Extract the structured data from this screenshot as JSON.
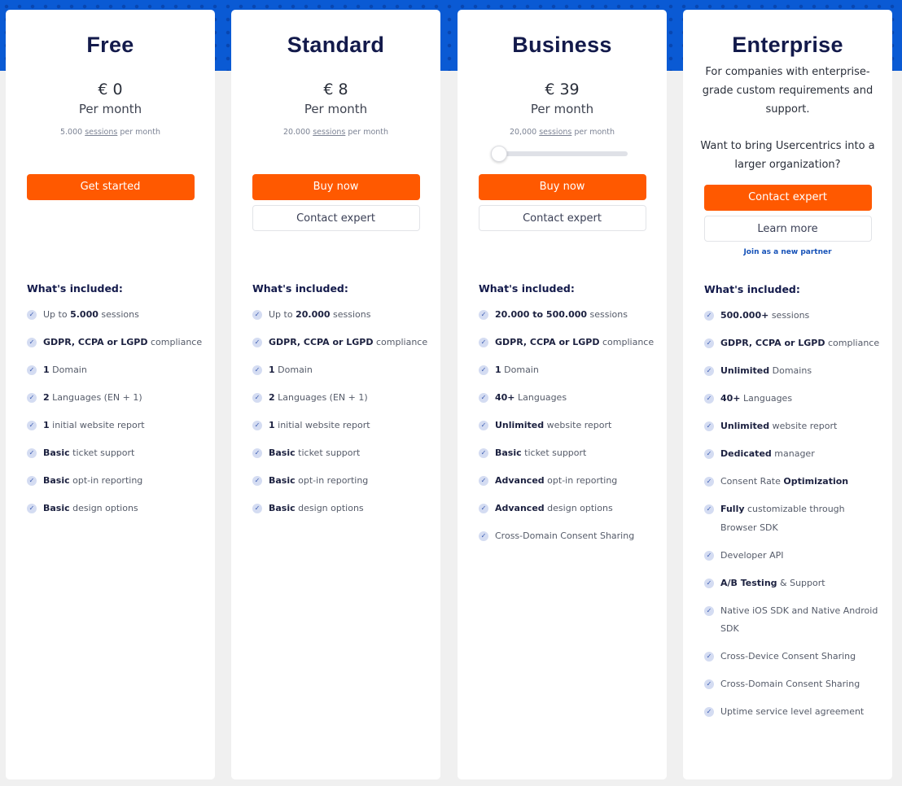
{
  "colors": {
    "accent": "#ff5900",
    "brand_blue": "#0a5ad4",
    "heading": "#131a4b"
  },
  "plans": [
    {
      "title": "Free",
      "price": "€ 0",
      "per": "Per month",
      "sessions_count": "5.000",
      "sessions_link": "sessions",
      "sessions_suffix": "per month",
      "primary": "Get started",
      "features_title": "What's included:",
      "features": [
        [
          {
            "t": "Up to "
          },
          {
            "t": "5.000",
            "b": 1
          },
          {
            "t": " sessions"
          }
        ],
        [
          {
            "t": "GDPR, CCPA or LGPD",
            "b": 1
          },
          {
            "t": " compliance"
          }
        ],
        [
          {
            "t": "1",
            "b": 1
          },
          {
            "t": " Domain"
          }
        ],
        [
          {
            "t": "2",
            "b": 1
          },
          {
            "t": " Languages (EN + 1)"
          }
        ],
        [
          {
            "t": "1",
            "b": 1
          },
          {
            "t": " initial website report"
          }
        ],
        [
          {
            "t": "Basic",
            "b": 1
          },
          {
            "t": " ticket support"
          }
        ],
        [
          {
            "t": "Basic",
            "b": 1
          },
          {
            "t": " opt-in reporting"
          }
        ],
        [
          {
            "t": "Basic",
            "b": 1
          },
          {
            "t": " design options"
          }
        ]
      ]
    },
    {
      "title": "Standard",
      "price": "€ 8",
      "per": "Per month",
      "sessions_count": "20.000",
      "sessions_link": "sessions",
      "sessions_suffix": "per month",
      "primary": "Buy now",
      "secondary": "Contact expert",
      "features_title": "What's included:",
      "features": [
        [
          {
            "t": "Up to "
          },
          {
            "t": "20.000",
            "b": 1
          },
          {
            "t": " sessions"
          }
        ],
        [
          {
            "t": "GDPR, CCPA or LGPD",
            "b": 1
          },
          {
            "t": " compliance"
          }
        ],
        [
          {
            "t": "1",
            "b": 1
          },
          {
            "t": " Domain"
          }
        ],
        [
          {
            "t": "2",
            "b": 1
          },
          {
            "t": " Languages (EN + 1)"
          }
        ],
        [
          {
            "t": "1",
            "b": 1
          },
          {
            "t": " initial website report"
          }
        ],
        [
          {
            "t": "Basic",
            "b": 1
          },
          {
            "t": " ticket support"
          }
        ],
        [
          {
            "t": "Basic",
            "b": 1
          },
          {
            "t": " opt-in reporting"
          }
        ],
        [
          {
            "t": "Basic",
            "b": 1
          },
          {
            "t": " design options"
          }
        ]
      ]
    },
    {
      "title": "Business",
      "price": "€ 39",
      "per": "Per month",
      "sessions_count": "20,000",
      "sessions_link": "sessions",
      "sessions_suffix": "per month",
      "slider_value": 0,
      "primary": "Buy now",
      "secondary": "Contact expert",
      "features_title": "What's included:",
      "features": [
        [
          {
            "t": "20.000 to 500.000",
            "b": 1
          },
          {
            "t": " sessions"
          }
        ],
        [
          {
            "t": "GDPR, CCPA or LGPD",
            "b": 1
          },
          {
            "t": " compliance"
          }
        ],
        [
          {
            "t": "1",
            "b": 1
          },
          {
            "t": " Domain"
          }
        ],
        [
          {
            "t": "40+",
            "b": 1
          },
          {
            "t": " Languages"
          }
        ],
        [
          {
            "t": "Unlimited",
            "b": 1
          },
          {
            "t": " website report"
          }
        ],
        [
          {
            "t": "Basic",
            "b": 1
          },
          {
            "t": " ticket support"
          }
        ],
        [
          {
            "t": "Advanced",
            "b": 1
          },
          {
            "t": " opt-in reporting"
          }
        ],
        [
          {
            "t": "Advanced",
            "b": 1
          },
          {
            "t": " design options"
          }
        ],
        [
          {
            "t": "Cross-Domain Consent Sharing"
          }
        ]
      ]
    },
    {
      "title": "Enterprise",
      "description": "For companies with enterprise-grade custom requirements and support.",
      "question": "Want to bring Usercentrics into a larger organization?",
      "primary": "Contact expert",
      "secondary": "Learn more",
      "partner_link": "Join as a new partner",
      "features_title": "What's included:",
      "features": [
        [
          {
            "t": "500.000+",
            "b": 1
          },
          {
            "t": " sessions"
          }
        ],
        [
          {
            "t": "GDPR, CCPA or LGPD",
            "b": 1
          },
          {
            "t": " compliance"
          }
        ],
        [
          {
            "t": "Unlimited",
            "b": 1
          },
          {
            "t": " Domains"
          }
        ],
        [
          {
            "t": "40+",
            "b": 1
          },
          {
            "t": " Languages"
          }
        ],
        [
          {
            "t": "Unlimited",
            "b": 1
          },
          {
            "t": " website report"
          }
        ],
        [
          {
            "t": "Dedicated",
            "b": 1
          },
          {
            "t": " manager"
          }
        ],
        [
          {
            "t": "Consent Rate "
          },
          {
            "t": "Optimization",
            "b": 1
          }
        ],
        [
          {
            "t": "Fully",
            "b": 1
          },
          {
            "t": " customizable through Browser SDK"
          }
        ],
        [
          {
            "t": "Developer API"
          }
        ],
        [
          {
            "t": "A/B Testing",
            "b": 1
          },
          {
            "t": " & Support"
          }
        ],
        [
          {
            "t": "Native iOS SDK and Native Android SDK"
          }
        ],
        [
          {
            "t": "Cross-Device Consent Sharing"
          }
        ],
        [
          {
            "t": "Cross-Domain Consent Sharing"
          }
        ],
        [
          {
            "t": "Uptime service level agreement"
          }
        ]
      ]
    }
  ]
}
